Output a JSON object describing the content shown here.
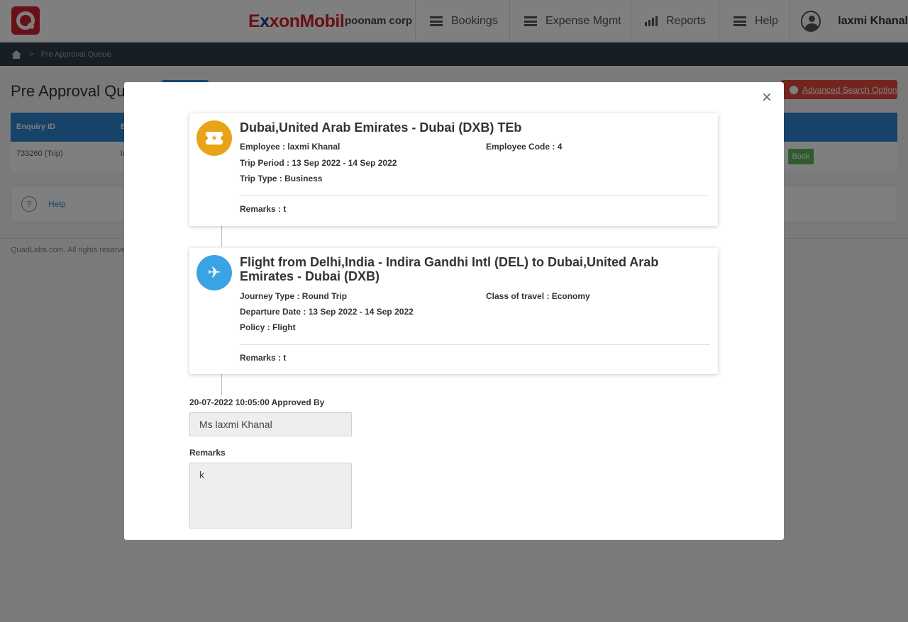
{
  "header": {
    "brand_pre": "E",
    "brand_x": "x",
    "brand_mid": "xon",
    "brand_post": "Mobil",
    "company": "poonam corp",
    "nav": [
      {
        "label": "Bookings",
        "icon": "menu-icon"
      },
      {
        "label": "Expense Mgmt",
        "icon": "menu-icon"
      },
      {
        "label": "Reports",
        "icon": "bar-chart-icon"
      },
      {
        "label": "Help",
        "icon": "menu-icon"
      }
    ],
    "user_name": "laxmi Khanal"
  },
  "breadcrumb": {
    "separator": ">",
    "current": "Pre Approval Queue"
  },
  "page": {
    "title": "Pre Approval Qu",
    "advanced_search_label": "Advanced Search Option",
    "table": {
      "columns": [
        "Enquiry ID",
        "E"
      ],
      "rows": [
        {
          "enquiry_id": "733260 (Trip)",
          "col2": "la",
          "action": "Book"
        }
      ]
    },
    "help_label": "Help",
    "help_glyph": "?",
    "footer": "QuadLabs.com. All rights reserve"
  },
  "modal": {
    "close_glyph": "×",
    "trip_card": {
      "icon_glyph": "★",
      "title": "Dubai,United Arab Emirates - Dubai (DXB) TEb",
      "employee": "Employee : laxmi Khanal",
      "employee_code": "Employee Code : 4",
      "trip_period": "Trip Period : 13 Sep 2022 - 14 Sep 2022",
      "trip_type": "Trip Type : Business",
      "remarks": "Remarks :  t"
    },
    "flight_card": {
      "icon_glyph": "✈",
      "title": "Flight from Delhi,India - Indira Gandhi Intl (DEL) to Dubai,United Arab Emirates - Dubai (DXB)",
      "journey_type": "Journey Type : Round Trip",
      "class_of_travel": "Class of travel : Economy",
      "departure_date": "Departure Date : 13 Sep 2022 - 14 Sep 2022",
      "policy": "Policy : Flight",
      "remarks": "Remarks : t"
    },
    "approval": {
      "approved_by_label": "20-07-2022 10:05:00 Approved By",
      "approved_by_value": "Ms laxmi Khanal",
      "remarks_label": "Remarks",
      "remarks_value": "k"
    }
  },
  "colors": {
    "brand_red": "#d0202e",
    "trip_icon": "#e8a317",
    "flight_icon": "#3aa3e3",
    "table_header": "#2f86d3",
    "book_button": "#5cb85c"
  }
}
